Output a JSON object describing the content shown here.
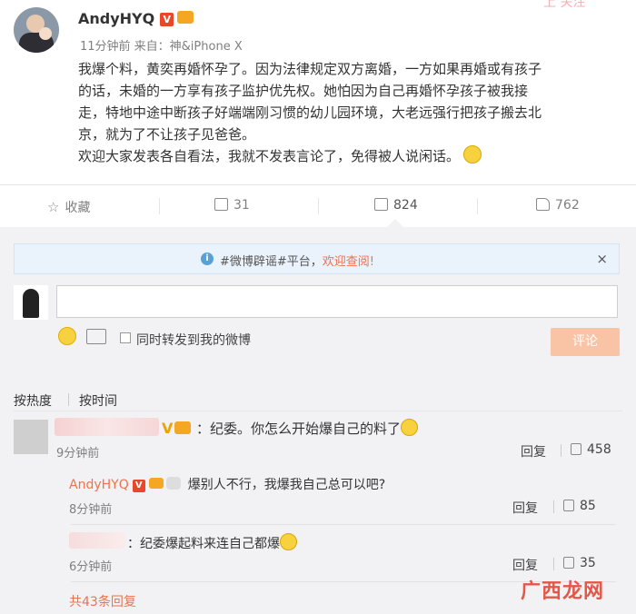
{
  "post": {
    "username": "AndyHYQ",
    "vip_badge": "V",
    "meta": "11分钟前 来自：神&iPhone X",
    "corner_text": "上 关注",
    "lines": [
      "我爆个料，黄奕再婚怀孕了。因为法律规定双方离婚，一方如果再婚或有孩子",
      "的话，未婚的一方享有孩子监护优先权。她怕因为自己再婚怀孕孩子被我接",
      "走，特地中途中断孩子好端端刚习惯的幼儿园环境，大老远强行把孩子搬去北",
      "京，就为了不让孩子见爸爸。",
      "欢迎大家发表各自看法，我就不发表言论了，免得被人说闲话。"
    ]
  },
  "actions": {
    "favorite": "收藏",
    "repost": "31",
    "comments": "824",
    "likes": "762"
  },
  "notice": {
    "text": "#微博辟谣#平台，",
    "link": "欢迎查阅!",
    "close": "×"
  },
  "composer": {
    "placeholder": "",
    "repost_label": "同时转发到我的微博",
    "submit": "评论"
  },
  "sort": {
    "hot": "按热度",
    "time": "按时间"
  },
  "comments": [
    {
      "text": "：纪委。你怎么开始爆自己的料了",
      "time": "9分钟前",
      "reply": "回复",
      "likes": "458",
      "badge": "V"
    }
  ],
  "replies": [
    {
      "name": "AndyHYQ",
      "badge": "V",
      "text": "爆别人不行，我爆我自己总可以吧?",
      "time": "8分钟前",
      "reply": "回复",
      "likes": "85"
    },
    {
      "name": "",
      "text": "：纪委爆起料来连自己都爆",
      "time": "6分钟前",
      "reply": "回复",
      "likes": "35"
    }
  ],
  "more_replies": "共43条回复",
  "watermark": "广西龙网",
  "colors": {
    "accent": "#eb7350",
    "vip": "#e8472a",
    "muted": "#808080"
  }
}
